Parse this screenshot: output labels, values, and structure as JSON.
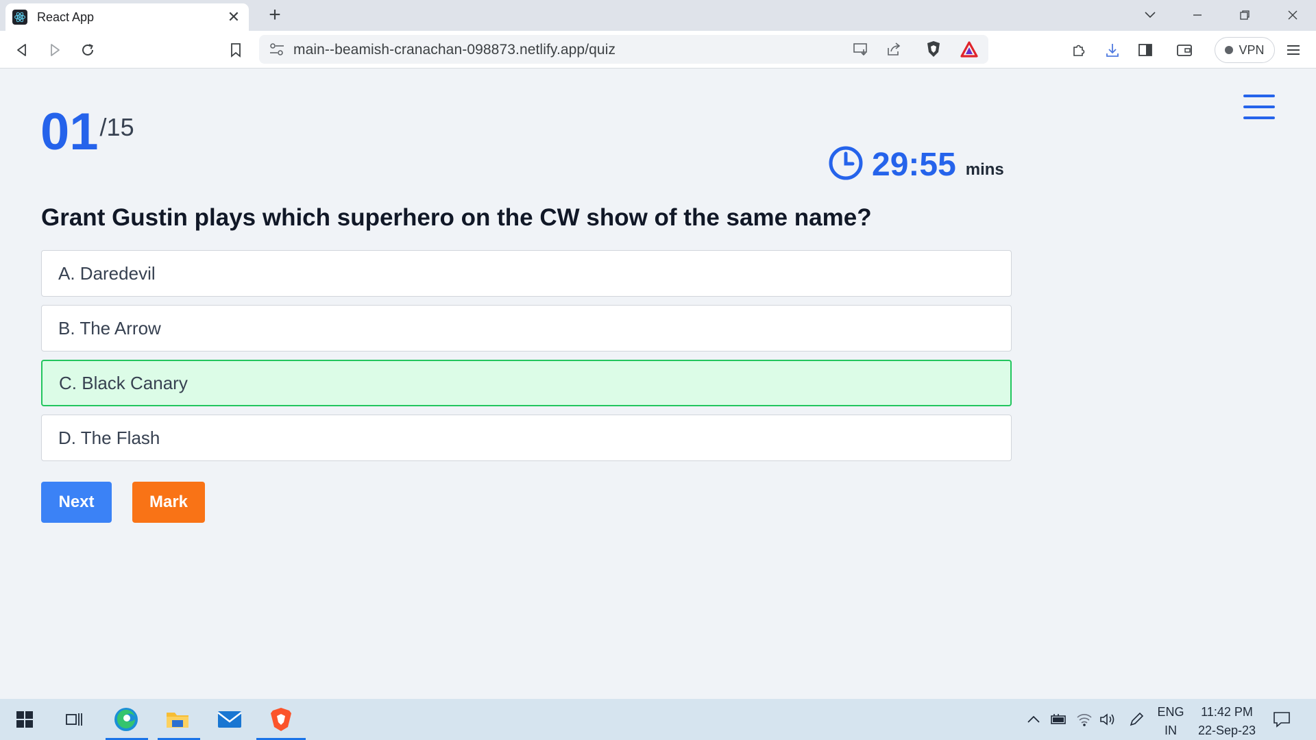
{
  "browser": {
    "tab_title": "React App",
    "tab_close": "✕",
    "new_tab": "+",
    "url": "main--beamish-cranachan-098873.netlify.app/quiz",
    "vpn_label": "VPN"
  },
  "quiz": {
    "current": "01",
    "total": "/15",
    "timer_value": "29:55",
    "timer_unit": "mins",
    "question": "Grant Gustin plays which superhero on the CW show of the same name?",
    "options": [
      {
        "label": "A. Daredevil",
        "selected": false
      },
      {
        "label": "B. The Arrow",
        "selected": false
      },
      {
        "label": "C. Black Canary",
        "selected": true
      },
      {
        "label": "D. The Flash",
        "selected": false
      }
    ],
    "next_label": "Next",
    "mark_label": "Mark"
  },
  "colors": {
    "accent": "#2563eb",
    "next_button": "#3b82f6",
    "mark_button": "#f97316",
    "selected_bg": "#dcfce7",
    "selected_border": "#22c55e",
    "page_bg": "#f0f3f7"
  },
  "taskbar": {
    "language_line1": "ENG",
    "language_line2": "IN",
    "time": "11:42 PM",
    "date": "22-Sep-23"
  }
}
